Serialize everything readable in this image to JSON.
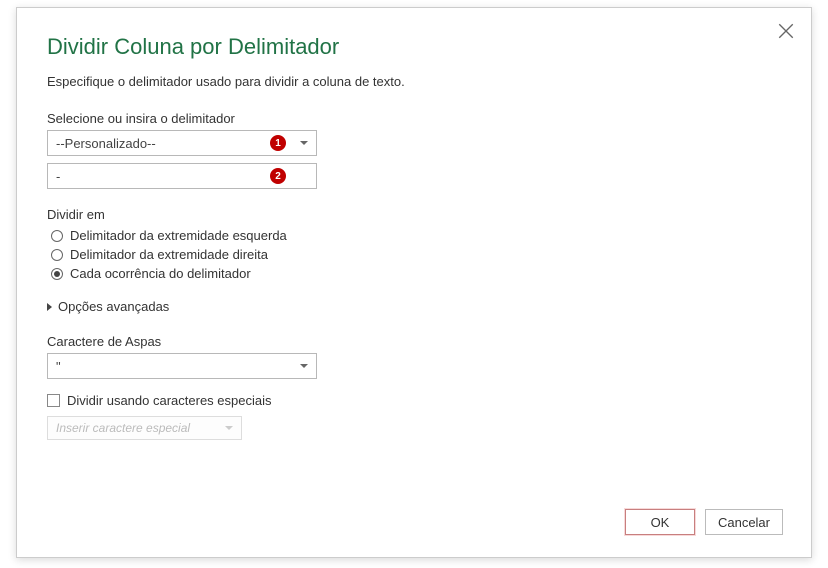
{
  "dialog": {
    "title": "Dividir Coluna por Delimitador",
    "subtitle": "Especifique o delimitador usado para dividir a coluna de texto.",
    "delimiter": {
      "label": "Selecione ou insira o delimitador",
      "selectValue": "--Personalizado--",
      "customValue": "-",
      "badge1": "1",
      "badge2": "2"
    },
    "split": {
      "label": "Dividir em",
      "options": [
        {
          "label": "Delimitador da extremidade esquerda",
          "checked": false
        },
        {
          "label": "Delimitador da extremidade direita",
          "checked": false
        },
        {
          "label": "Cada ocorrência do delimitador",
          "checked": true
        }
      ]
    },
    "advanced": {
      "label": "Opções avançadas"
    },
    "quote": {
      "label": "Caractere de Aspas",
      "value": "\""
    },
    "special": {
      "checkboxLabel": "Dividir usando caracteres especiais",
      "insertLabel": "Inserir caractere especial"
    },
    "buttons": {
      "ok": "OK",
      "cancel": "Cancelar"
    }
  }
}
